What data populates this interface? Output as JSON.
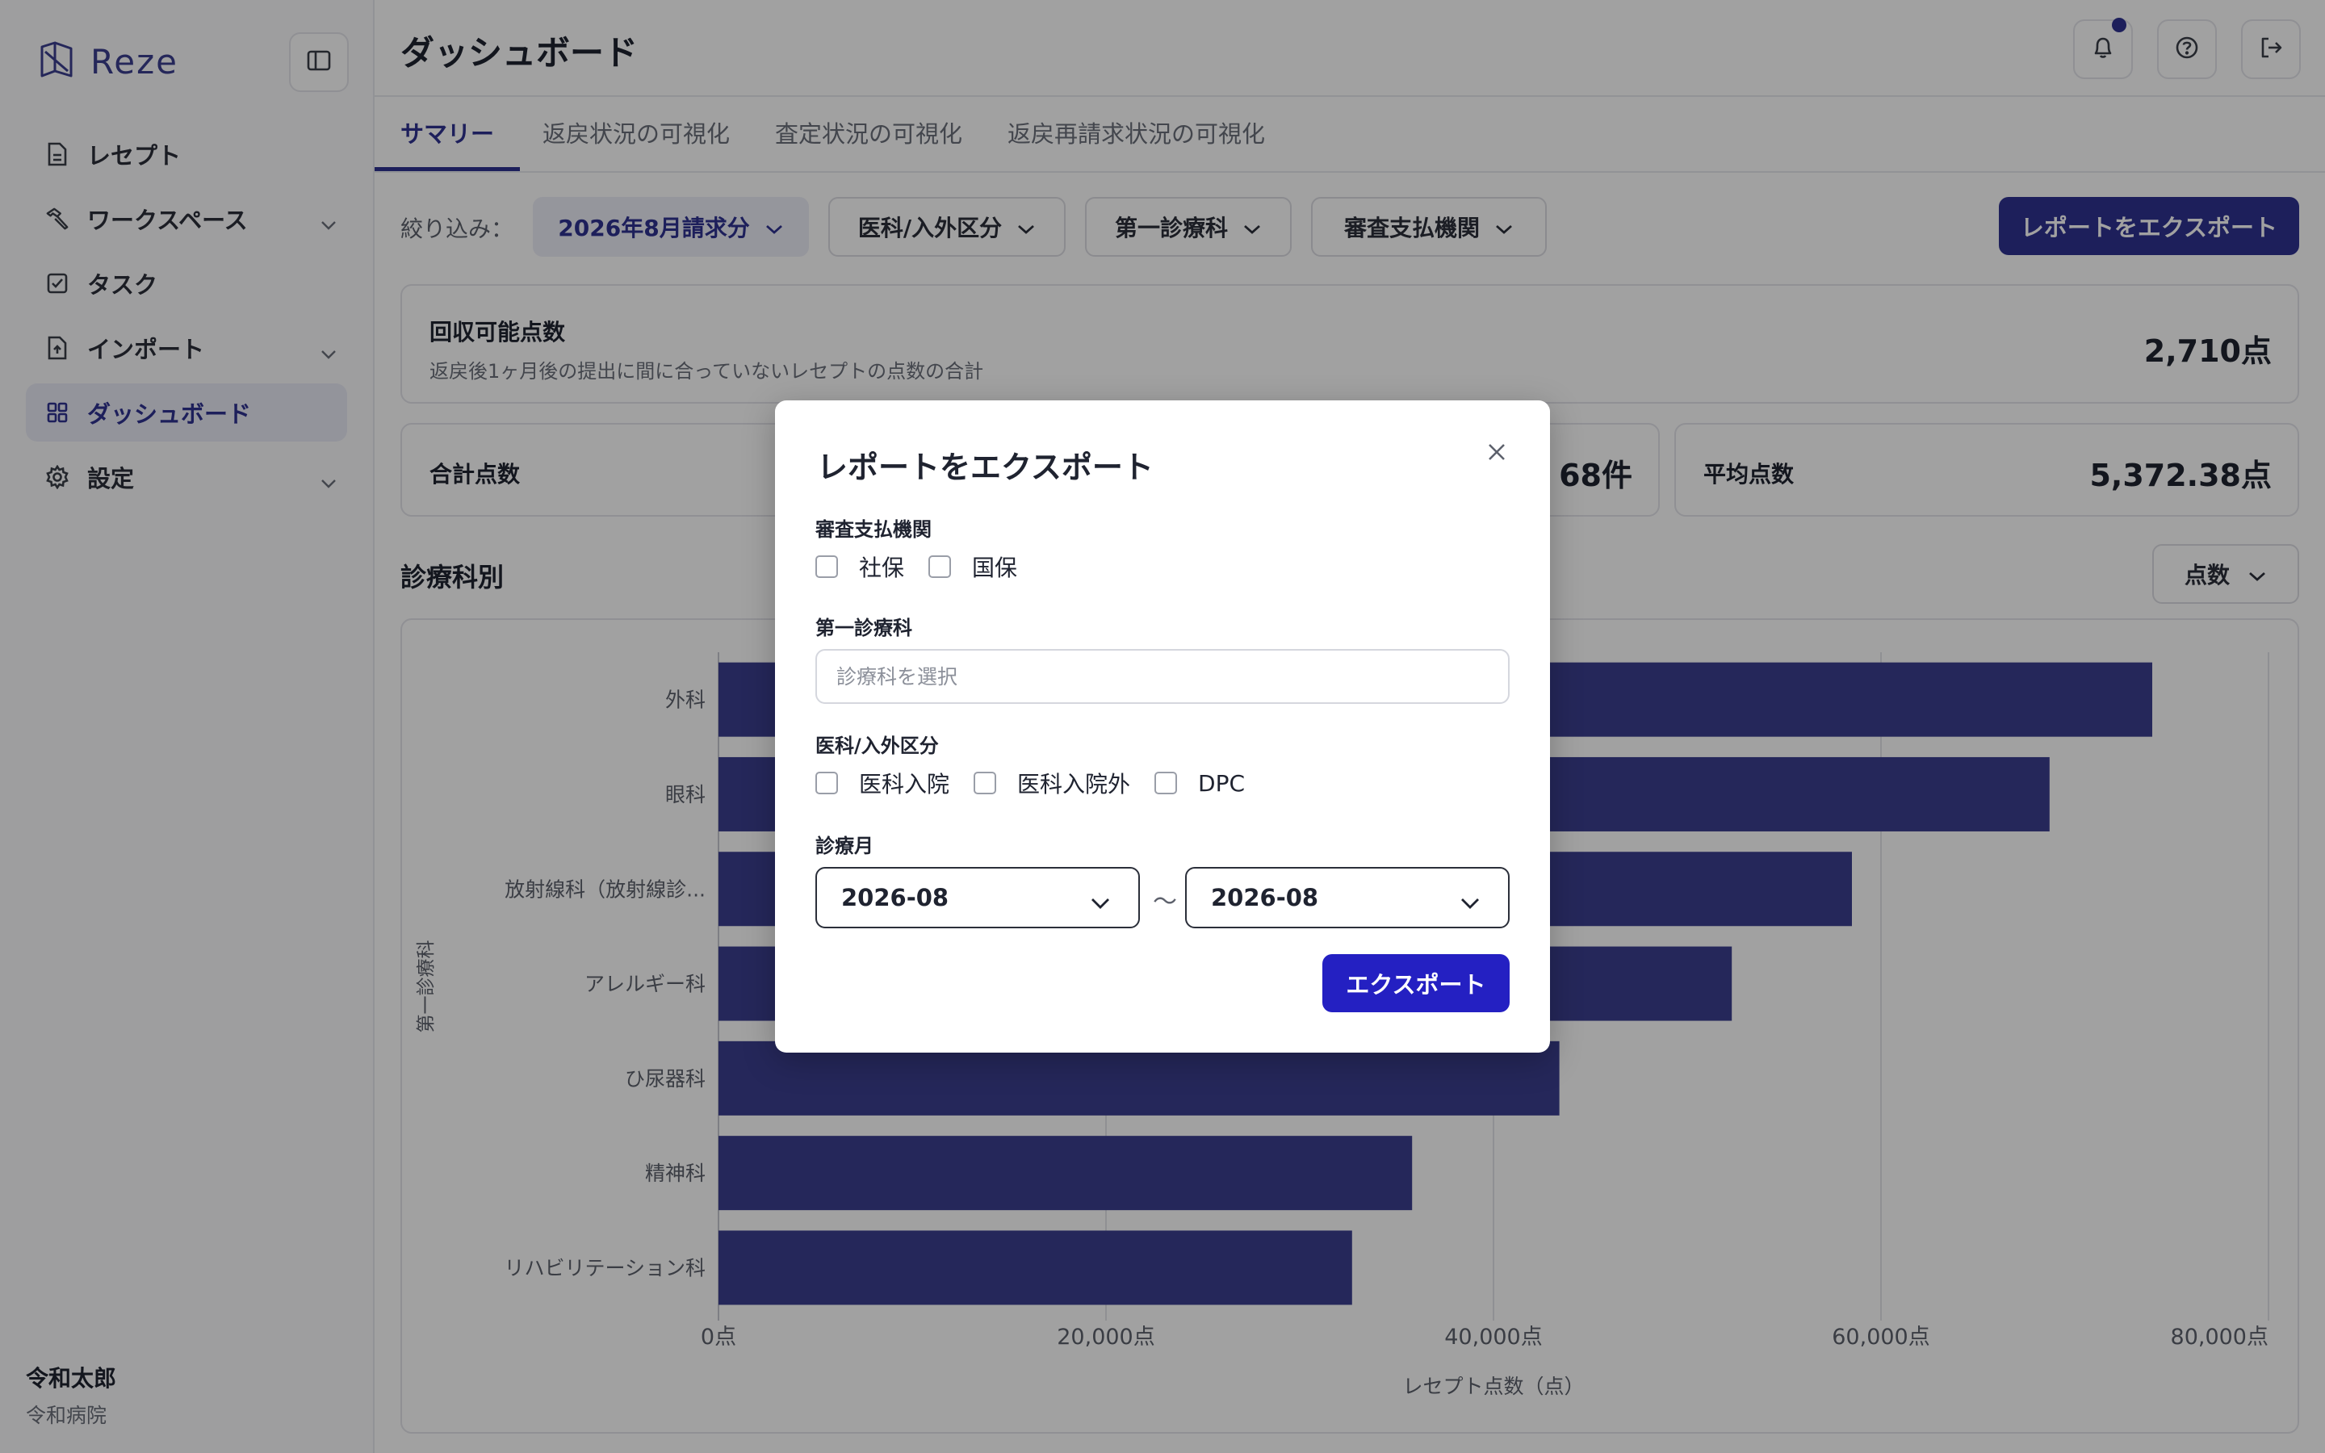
{
  "app": {
    "brand": "Reze",
    "title": "ダッシュボード"
  },
  "sidebar": {
    "items": [
      {
        "label": "レセプト",
        "icon": "document-icon",
        "active": false,
        "expandable": false
      },
      {
        "label": "ワークスペース",
        "icon": "hammer-icon",
        "active": false,
        "expandable": true
      },
      {
        "label": "タスク",
        "icon": "checkbox-icon",
        "active": false,
        "expandable": false
      },
      {
        "label": "インポート",
        "icon": "import-file-icon",
        "active": false,
        "expandable": true
      },
      {
        "label": "ダッシュボード",
        "icon": "grid-icon",
        "active": true,
        "expandable": false
      },
      {
        "label": "設定",
        "icon": "gear-icon",
        "active": false,
        "expandable": true
      }
    ],
    "user": {
      "name": "令和太郎",
      "org": "令和病院"
    }
  },
  "tabs": [
    {
      "label": "サマリー",
      "active": true
    },
    {
      "label": "返戻状況の可視化",
      "active": false
    },
    {
      "label": "査定状況の可視化",
      "active": false
    },
    {
      "label": "返戻再請求状況の可視化",
      "active": false
    }
  ],
  "filters": {
    "label": "絞り込み：",
    "items": [
      {
        "label": "2026年8月請求分",
        "active": true
      },
      {
        "label": "医科/入外区分",
        "active": false
      },
      {
        "label": "第一診療科",
        "active": false
      },
      {
        "label": "審査支払機関",
        "active": false
      }
    ],
    "export_label": "レポートをエクスポート"
  },
  "cards": {
    "recoverable": {
      "title": "回収可能点数",
      "desc": "返戻後1ヶ月後の提出に間に合っていないレセプトの点数の合計",
      "value": "2,710点"
    },
    "total": {
      "title": "合計点数",
      "value": "68件"
    },
    "average": {
      "title": "平均点数",
      "value": "5,372.38点"
    }
  },
  "section": {
    "title": "診療科別",
    "metric_select": "点数"
  },
  "chart_data": {
    "type": "bar",
    "orientation": "horizontal",
    "categories": [
      "外科",
      "眼科",
      "放射線科（放射線診...",
      "アレルギー科",
      "ひ尿器科",
      "精神科",
      "リハビリテーション科"
    ],
    "values": [
      74000,
      68700,
      58500,
      52300,
      43400,
      35800,
      32700
    ],
    "xticks": [
      "0点",
      "20,000点",
      "40,000点",
      "60,000点",
      "80,000点"
    ],
    "xlim": [
      0,
      80000
    ],
    "xlabel": "レセプト点数（点）",
    "ylabel": "第一診療科",
    "grid": true,
    "bar_color": "#3b3f8f"
  },
  "modal": {
    "title": "レポートをエクスポート",
    "payer": {
      "label": "審査支払機関",
      "options": [
        "社保",
        "国保"
      ]
    },
    "dept": {
      "label": "第一診療科",
      "placeholder": "診療科を選択"
    },
    "category": {
      "label": "医科/入外区分",
      "options": [
        "医科入院",
        "医科入院外",
        "DPC"
      ]
    },
    "month": {
      "label": "診療月",
      "from": "2026-08",
      "separator": "～",
      "to": "2026-08"
    },
    "export_button": "エクスポート"
  },
  "colors": {
    "brand": "#2f3191",
    "modal_button": "#2420c2",
    "overlay": "rgba(0,0,0,0.37)"
  }
}
